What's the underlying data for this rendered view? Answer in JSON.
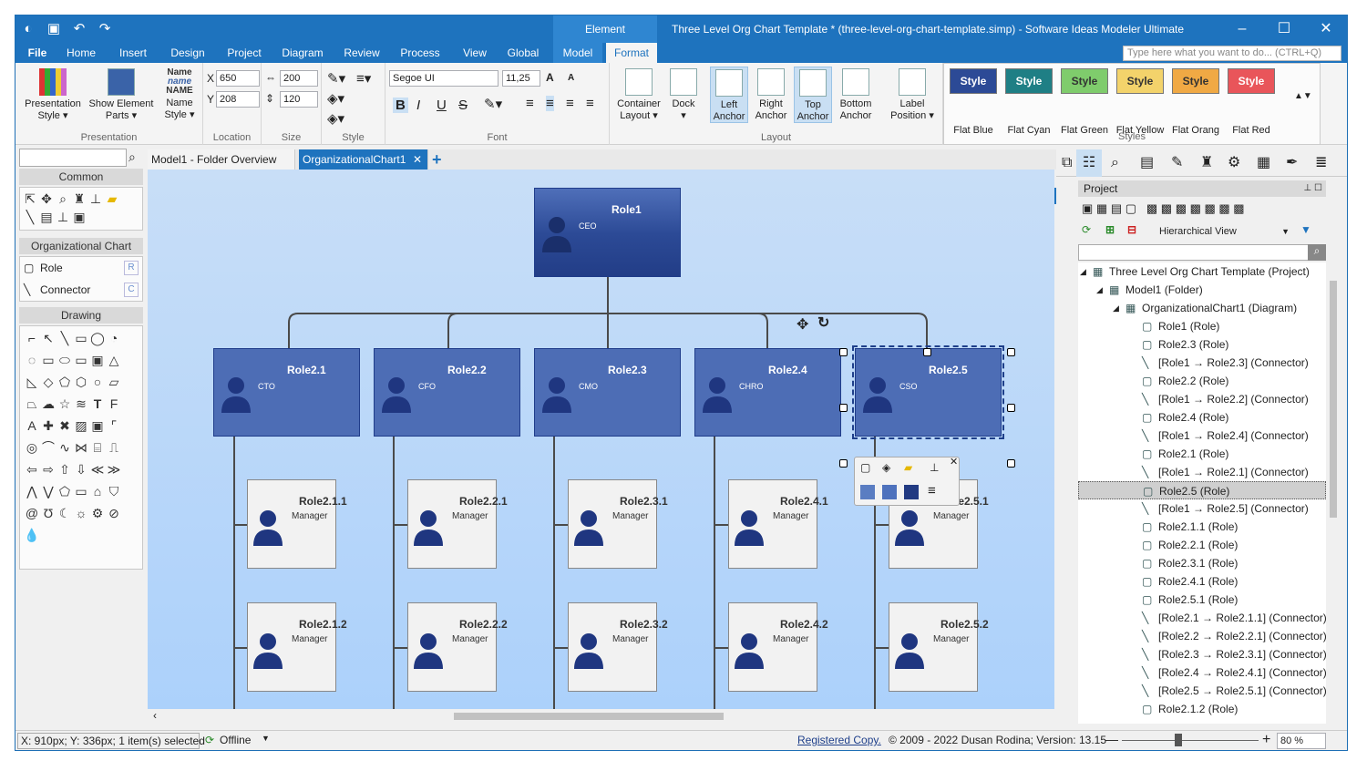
{
  "titlebar": {
    "context_tab": "Element",
    "title": "Three Level Org Chart Template * (three-level-org-chart-template.simp) - Software Ideas Modeler Ultimate"
  },
  "menu": {
    "tabs": [
      "File",
      "Home",
      "Insert",
      "Design",
      "Project",
      "Diagram",
      "Review",
      "Process",
      "View",
      "Global",
      "Model",
      "Format"
    ],
    "search_placeholder": "Type here what you want to do... (CTRL+Q)"
  },
  "ribbon": {
    "presentation": {
      "btn1": "Presentation Style",
      "btn2": "Show Element Parts",
      "btn3": "Name Style",
      "label": "Presentation",
      "name_samples": [
        "Name",
        "name",
        "NAME"
      ]
    },
    "location": {
      "x_label": "X",
      "x": "650",
      "y_label": "Y",
      "y": "208",
      "label": "Location"
    },
    "size": {
      "w": "200",
      "h": "120",
      "label": "Size"
    },
    "style": {
      "label": "Style"
    },
    "font": {
      "family": "Segoe UI",
      "size": "11,25",
      "label": "Font",
      "bold": "B",
      "italic": "I",
      "underline": "U",
      "strike": "S"
    },
    "layout": {
      "buttons": [
        "Container Layout",
        "Dock",
        "Left Anchor",
        "Right Anchor",
        "Top Anchor",
        "Bottom Anchor",
        "Label Position"
      ],
      "label": "Layout"
    },
    "styles": {
      "items": [
        {
          "box": "Style",
          "name": "Flat Blue",
          "color": "#2c4a96"
        },
        {
          "box": "Style",
          "name": "Flat Cyan",
          "color": "#1f7f85"
        },
        {
          "box": "Style",
          "name": "Flat Green",
          "color": "#7fcc6c"
        },
        {
          "box": "Style",
          "name": "Flat Yellow",
          "color": "#f3d36b"
        },
        {
          "box": "Style",
          "name": "Flat Orang",
          "color": "#f0a944"
        },
        {
          "box": "Style",
          "name": "Flat Red",
          "color": "#e9555a"
        }
      ],
      "label": "Styles"
    }
  },
  "toolbox": {
    "common": "Common",
    "org": "Organizational Chart",
    "role": "Role",
    "role_key": "R",
    "connector": "Connector",
    "connector_key": "C",
    "drawing": "Drawing"
  },
  "doctabs": {
    "tab1": "Model1 - Folder Overview",
    "tab2": "OrganizationalChart1"
  },
  "diagram": {
    "ceo": {
      "name": "Role1",
      "role": "CEO"
    },
    "level2": [
      {
        "name": "Role2.1",
        "role": "CTO"
      },
      {
        "name": "Role2.2",
        "role": "CFO"
      },
      {
        "name": "Role2.3",
        "role": "CMO"
      },
      {
        "name": "Role2.4",
        "role": "CHRO"
      },
      {
        "name": "Role2.5",
        "role": "CSO"
      }
    ],
    "level3a": [
      {
        "name": "Role2.1.1",
        "role": "Manager"
      },
      {
        "name": "Role2.2.1",
        "role": "Manager"
      },
      {
        "name": "Role2.3.1",
        "role": "Manager"
      },
      {
        "name": "Role2.4.1",
        "role": "Manager"
      },
      {
        "name": "Role2.5.1",
        "role": "Manager"
      }
    ],
    "level3b": [
      {
        "name": "Role2.1.2",
        "role": "Manager"
      },
      {
        "name": "Role2.2.2",
        "role": "Manager"
      },
      {
        "name": "Role2.3.2",
        "role": "Manager"
      },
      {
        "name": "Role2.4.2",
        "role": "Manager"
      },
      {
        "name": "Role2.5.2",
        "role": "Manager"
      }
    ]
  },
  "project": {
    "title": "Project",
    "view": "Hierarchical View",
    "tree": [
      {
        "t": "Three Level Org Chart Template (Project)",
        "lvl": 0
      },
      {
        "t": "Model1 (Folder)",
        "lvl": 1
      },
      {
        "t": "OrganizationalChart1 (Diagram)",
        "lvl": 2
      },
      {
        "t": "Role1 (Role)",
        "lvl": 3
      },
      {
        "t": "Role2.3 (Role)",
        "lvl": 3
      },
      {
        "t": "[Role1 → Role2.3] (Connector)",
        "lvl": 3
      },
      {
        "t": "Role2.2 (Role)",
        "lvl": 3
      },
      {
        "t": "[Role1 → Role2.2] (Connector)",
        "lvl": 3
      },
      {
        "t": "Role2.4 (Role)",
        "lvl": 3
      },
      {
        "t": "[Role1 → Role2.4] (Connector)",
        "lvl": 3
      },
      {
        "t": "Role2.1 (Role)",
        "lvl": 3
      },
      {
        "t": "[Role1 → Role2.1] (Connector)",
        "lvl": 3
      },
      {
        "t": "Role2.5 (Role)",
        "lvl": 3,
        "sel": true
      },
      {
        "t": "[Role1 → Role2.5] (Connector)",
        "lvl": 3
      },
      {
        "t": "Role2.1.1 (Role)",
        "lvl": 3
      },
      {
        "t": "Role2.2.1 (Role)",
        "lvl": 3
      },
      {
        "t": "Role2.3.1 (Role)",
        "lvl": 3
      },
      {
        "t": "Role2.4.1 (Role)",
        "lvl": 3
      },
      {
        "t": "Role2.5.1 (Role)",
        "lvl": 3
      },
      {
        "t": "[Role2.1 → Role2.1.1] (Connector)",
        "lvl": 3
      },
      {
        "t": "[Role2.2 → Role2.2.1] (Connector)",
        "lvl": 3
      },
      {
        "t": "[Role2.3 → Role2.3.1] (Connector)",
        "lvl": 3
      },
      {
        "t": "[Role2.4 → Role2.4.1] (Connector)",
        "lvl": 3
      },
      {
        "t": "[Role2.5 → Role2.5.1] (Connector)",
        "lvl": 3
      },
      {
        "t": "Role2.1.2 (Role)",
        "lvl": 3
      }
    ]
  },
  "status": {
    "coords": "X: 910px; Y: 336px; 1 item(s) selected",
    "online": "Offline",
    "registered": "Registered Copy.",
    "copyright": "© 2009 - 2022 Dusan Rodina; Version: 13.15",
    "zoom": "80 %"
  }
}
